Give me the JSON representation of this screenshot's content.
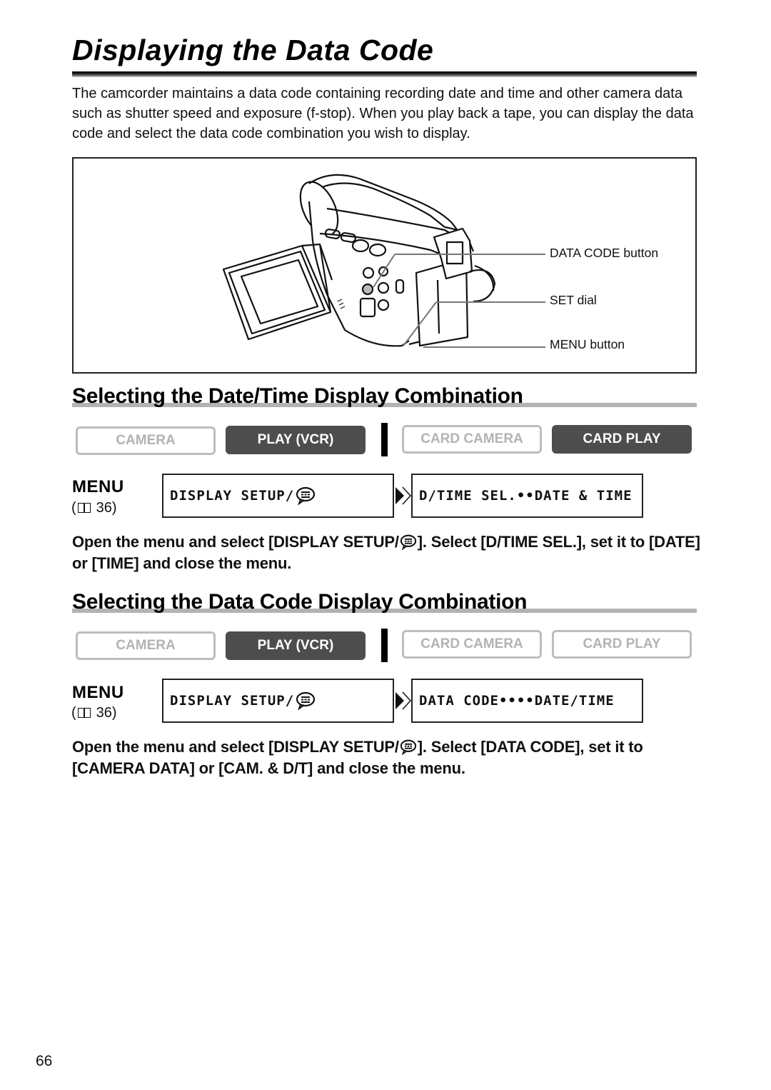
{
  "page": {
    "title": "Displaying the Data Code",
    "intro": "The camcorder maintains a data code containing recording date and time and other camera data such as shutter speed and exposure (f-stop). When you play back a tape, you can display the data code and select the data code combination you wish to display.",
    "page_number": "66"
  },
  "figure": {
    "illustration": "camcorder-with-open-lcd-screen",
    "callouts": [
      {
        "label": "DATA CODE button"
      },
      {
        "label": "SET dial"
      },
      {
        "label": "MENU button"
      }
    ]
  },
  "sections": [
    {
      "heading": "Selecting the Date/Time Display Combination",
      "modes": [
        {
          "label": "CAMERA",
          "active": false
        },
        {
          "label": "PLAY (VCR)",
          "active": true
        },
        {
          "label": "CARD CAMERA",
          "active": false
        },
        {
          "label": "CARD PLAY",
          "active": true
        }
      ],
      "menu_label": "MENU",
      "menu_ref": "36)",
      "menu_ref_open": "(",
      "menu_path": [
        "DISPLAY SETUP/",
        "D/TIME SEL.••DATE & TIME"
      ],
      "instruction_part1": "Open the menu and select [DISPLAY SETUP/",
      "instruction_part2": "]. Select [D/TIME SEL.], set it to [DATE] or [TIME] and close the menu."
    },
    {
      "heading": "Selecting the Data Code Display Combination",
      "modes": [
        {
          "label": "CAMERA",
          "active": false
        },
        {
          "label": "PLAY (VCR)",
          "active": true
        },
        {
          "label": "CARD CAMERA",
          "active": false
        },
        {
          "label": "CARD PLAY",
          "active": false
        }
      ],
      "menu_label": "MENU",
      "menu_ref": "36)",
      "menu_ref_open": "(",
      "menu_path": [
        "DISPLAY SETUP/",
        "DATA CODE••••DATE/TIME"
      ],
      "instruction_part1": "Open the menu and select [DISPLAY SETUP/",
      "instruction_part2": "]. Select [DATA CODE], set it to [CAMERA DATA] or [CAM. & D/T] and close the menu."
    }
  ],
  "colors": {
    "mode_active_bg": "#4d4d4d",
    "mode_inactive_text": "#b3b3b3",
    "section_rule": "#b3b3b3"
  }
}
